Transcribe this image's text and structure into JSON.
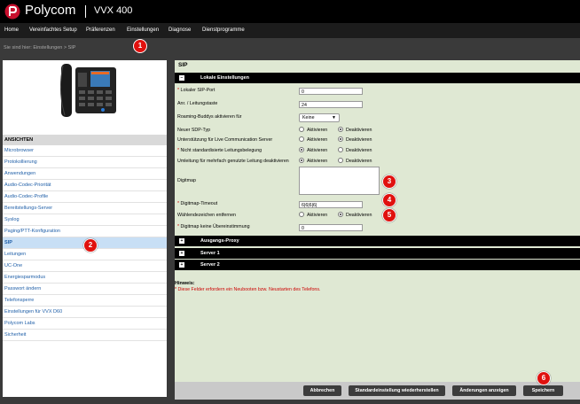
{
  "header": {
    "brand": "Polycom",
    "model": "VVX 400"
  },
  "nav": {
    "items": [
      "Home",
      "Vereinfachtes Setup",
      "Präferenzen",
      "Einstellungen",
      "Diagnose",
      "Dienstprogramme"
    ]
  },
  "breadcrumb": "Sie sind hier: Einstellungen > SIP",
  "badges": [
    "1",
    "2",
    "3",
    "4",
    "5",
    "6"
  ],
  "sidebar": {
    "heading": "ANSICHTEN",
    "items": [
      "Microbrowser",
      "Protokollierung",
      "Anwendungen",
      "Audio-Codec-Priorität",
      "Audio-Codec-Profile",
      "Bereitstellungs-Server",
      "Syslog",
      "Paging/PTT-Konfiguration",
      "SIP",
      "Leitungen",
      "UC-One",
      "Energiesparmodus",
      "Passwort ändern",
      "Telefonsperre",
      "Einstellungen für VVX D60",
      "Polycom Labs",
      "Sicherheit"
    ],
    "active_index": 8
  },
  "main": {
    "title": "SIP",
    "section_local": {
      "toggle": "−",
      "label": "Lokale Einstellungen"
    },
    "fields": {
      "local_port": {
        "label": "Lokaler SIP-Port",
        "value": "0"
      },
      "line_key": {
        "label": "Anr. / Leitungstaste",
        "value": "24"
      },
      "roaming": {
        "label": "Roaming-Buddys aktivieren für",
        "value": "Keine"
      },
      "sdp": {
        "label": "Neuer SDP-Typ",
        "on": "Aktivieren",
        "off": "Deaktivieren",
        "selected": "off"
      },
      "lcs": {
        "label": "Unterstützung für Live Communication Server",
        "on": "Aktivieren",
        "off": "Deaktivieren",
        "selected": "off"
      },
      "nonstd": {
        "label": "Nicht standardisierte Leitungsbelegung",
        "on": "Aktivieren",
        "off": "Deaktivieren",
        "selected": "on"
      },
      "multi": {
        "label": "Umleitung für mehrfach genutzte Leitung deaktivieren",
        "on": "Aktivieren",
        "off": "Deaktivieren",
        "selected": "on"
      },
      "digitmap": {
        "label": "Digitmap",
        "value": ""
      },
      "digitmap_timeout": {
        "label": "Digitmap-Timeout",
        "value": "6|6|6|6|"
      },
      "dialtone": {
        "label": "Wählendezeichen entfernen",
        "on": "Aktivieren",
        "off": "Deaktivieren",
        "selected": "off"
      },
      "no_match": {
        "label": "Digitmap keine Übereinstimmung",
        "value": "0"
      }
    },
    "sections_collapsed": [
      {
        "toggle": "+",
        "label": "Ausgangs-Proxy"
      },
      {
        "toggle": "+",
        "label": "Server 1"
      },
      {
        "toggle": "+",
        "label": "Server 2"
      }
    ],
    "hint_title": "Hinweis:",
    "hint_text": "* Diese Felder erfordern ein Neubooten bzw. Neustarten des Telefons."
  },
  "footer": {
    "cancel": "Abbrechen",
    "reset": "Standardeinstellung wiederherstellen",
    "show_changes": "Änderungen anzeigen",
    "save": "Speichern"
  },
  "colors": {
    "panel_bg": "#dfe8d3",
    "badge": "#e0110e",
    "link": "#1f5fa8",
    "required": "#cc0000"
  }
}
